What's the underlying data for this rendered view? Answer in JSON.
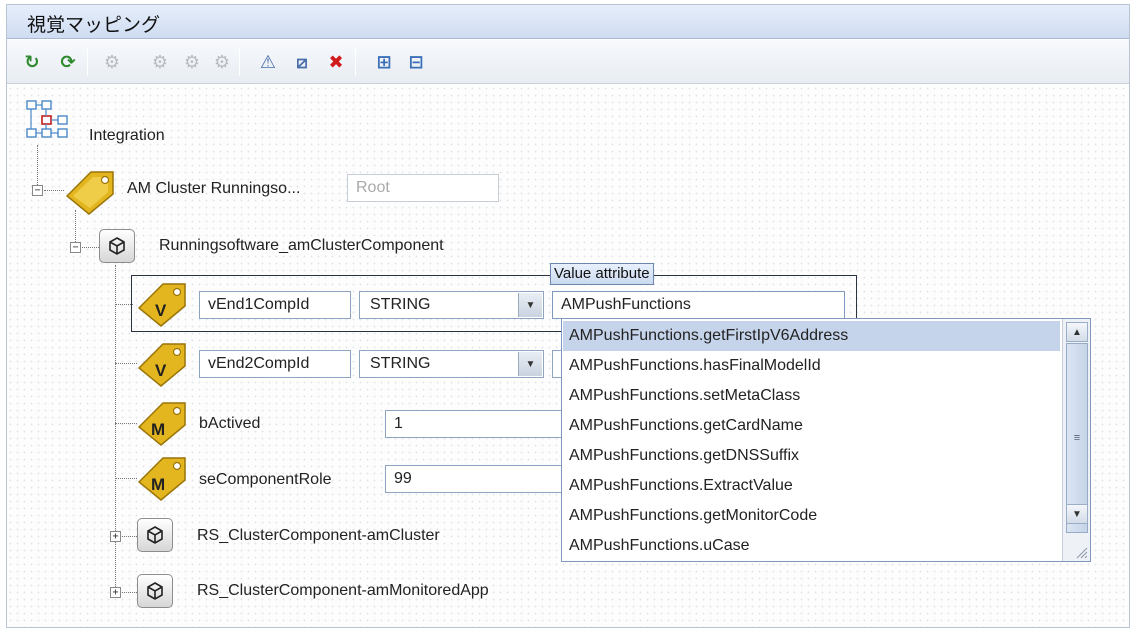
{
  "window": {
    "title": "視覚マッピング"
  },
  "toolbar": {
    "buttons": [
      {
        "icon": "refresh-info-icon",
        "glyph": "↻",
        "enabled": true,
        "color": "#2f8a2f"
      },
      {
        "icon": "sync-icon",
        "glyph": "⟳",
        "enabled": true,
        "color": "#2f8a2f"
      },
      {
        "icon": "gear-disabled-icon",
        "glyph": "⚙",
        "enabled": false
      },
      {
        "icon": "gear-disabled-icon-2",
        "glyph": "⚙",
        "enabled": false
      },
      {
        "icon": "gear-disabled-icon-3",
        "glyph": "⚙",
        "enabled": false
      },
      {
        "icon": "gear-disabled-icon-4",
        "glyph": "⚙",
        "enabled": false
      },
      {
        "icon": "validate-icon",
        "glyph": "⚠",
        "enabled": true,
        "color": "#4a6ea9"
      },
      {
        "icon": "clear-mapping-icon",
        "glyph": "⧄",
        "enabled": true,
        "color": "#4a6ea9"
      },
      {
        "icon": "delete-icon",
        "glyph": "✖",
        "enabled": true,
        "color": "#d11a1a"
      },
      {
        "icon": "expand-all-icon",
        "glyph": "⊞",
        "enabled": true,
        "color": "#3b6fb6"
      },
      {
        "icon": "collapse-all-icon",
        "glyph": "⊟",
        "enabled": true,
        "color": "#3b6fb6"
      }
    ]
  },
  "tree": {
    "root": {
      "label": "Integration"
    },
    "level1": {
      "label": "AM Cluster Runningso...",
      "placeholder": "Root"
    },
    "level2": {
      "label": "Runningsoftware_amClusterComponent"
    },
    "attributes": [
      {
        "badge": "V",
        "name": "vEnd1CompId",
        "type": "STRING",
        "value": "AMPushFunctions"
      },
      {
        "badge": "V",
        "name": "vEnd2CompId",
        "type": "STRING",
        "value": ""
      },
      {
        "badge": "M",
        "name": "bActived",
        "value": "1"
      },
      {
        "badge": "M",
        "name": "seComponentRole",
        "value": "99"
      }
    ],
    "children": [
      {
        "label": "RS_ClusterComponent-amCluster"
      },
      {
        "label": "RS_ClusterComponent-amMonitoredApp"
      }
    ]
  },
  "value_editor": {
    "caption": "Value attribute",
    "suggestions": [
      "AMPushFunctions.getFirstIpV6Address",
      "AMPushFunctions.hasFinalModelId",
      "AMPushFunctions.setMetaClass",
      "AMPushFunctions.getCardName",
      "AMPushFunctions.getDNSSuffix",
      "AMPushFunctions.ExtractValue",
      "AMPushFunctions.getMonitorCode",
      "AMPushFunctions.uCase"
    ],
    "selected_index": 0
  },
  "colors": {
    "tag_gold": "#e3b51f",
    "selection": "#c5d4ea",
    "titlebar": "#d7e3f5"
  }
}
